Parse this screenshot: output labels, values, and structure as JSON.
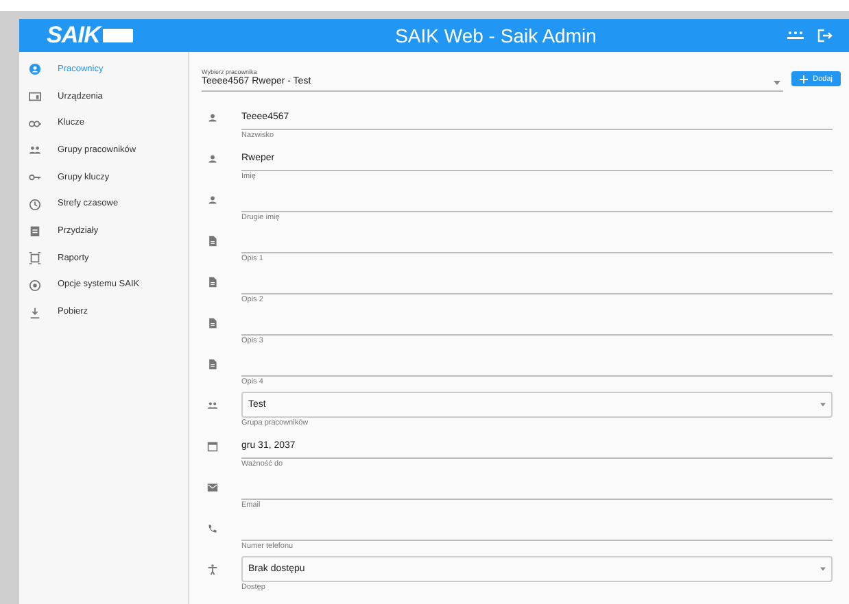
{
  "header": {
    "logo": "SAIK",
    "title": "SAIK Web - Saik Admin"
  },
  "sidebar": {
    "items": [
      {
        "label": "Pracownicy",
        "selected": true
      },
      {
        "label": "Urządzenia",
        "selected": false
      },
      {
        "label": "Klucze",
        "selected": false
      },
      {
        "label": "Grupy pracowników",
        "selected": false
      },
      {
        "label": "Grupy kluczy",
        "selected": false
      },
      {
        "label": "Strefy czasowe",
        "selected": false
      },
      {
        "label": "Przydziały",
        "selected": false
      },
      {
        "label": "Raporty",
        "selected": false
      },
      {
        "label": "Opcje systemu SAIK",
        "selected": false
      },
      {
        "label": "Pobierz",
        "selected": false
      }
    ]
  },
  "employee_select": {
    "label": "Wybierz pracownika",
    "value": "Teeee4567 Rweper - Test"
  },
  "add_button": {
    "label": "Dodaj"
  },
  "fields": [
    {
      "kind": "text",
      "value": "Teeee4567",
      "label": "Nazwisko"
    },
    {
      "kind": "text",
      "value": "Rweper",
      "label": "Imię"
    },
    {
      "kind": "text",
      "label": "Drugie imię"
    },
    {
      "kind": "text",
      "label": "Opis 1"
    },
    {
      "kind": "text",
      "label": "Opis 2"
    },
    {
      "kind": "text",
      "label": "Opis 3"
    },
    {
      "kind": "text",
      "label": "Opis 4"
    },
    {
      "kind": "select",
      "value": "Test",
      "label": "Grupa pracowników"
    },
    {
      "kind": "text",
      "value": "gru 31, 2037",
      "label": "Ważność do"
    },
    {
      "kind": "text",
      "label": "Email"
    },
    {
      "kind": "text",
      "label": "Numer telefonu"
    },
    {
      "kind": "select",
      "value": "Brak dostępu",
      "label": "Dostęp"
    }
  ]
}
